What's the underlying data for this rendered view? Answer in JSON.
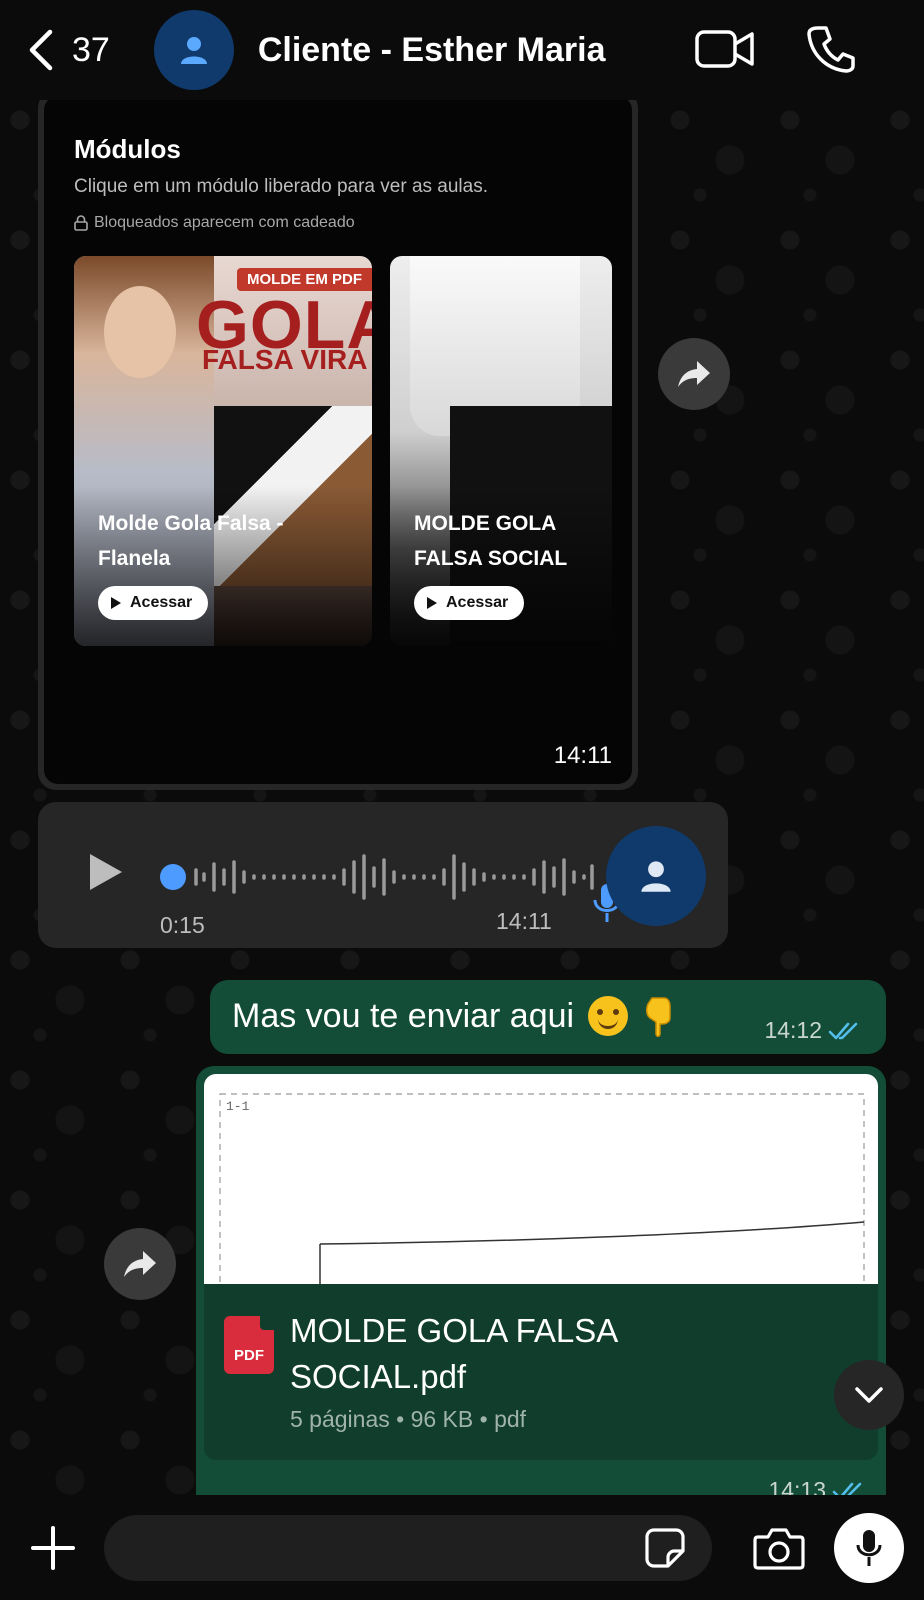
{
  "header": {
    "back_count": "37",
    "contact_name": "Cliente - Esther Maria"
  },
  "image_message": {
    "title": "Módulos",
    "subtitle": "Clique em um módulo liberado para ver as aulas.",
    "lock_note": "Bloqueados aparecem com cadeado",
    "cards": [
      {
        "badge": "MOLDE EM PDF",
        "headline": "GOLA",
        "headline2": "FALSA VIRA",
        "title": "Molde Gola Falsa - Flanela",
        "button": "Acessar"
      },
      {
        "title": "MOLDE GOLA FALSA SOCIAL",
        "button": "Acessar"
      }
    ],
    "time": "14:11"
  },
  "voice_message": {
    "duration": "0:15",
    "time": "14:11"
  },
  "outgoing_text": {
    "text": "Mas vou te enviar aqui",
    "time": "14:12"
  },
  "document_message": {
    "preview_label": "1-1",
    "icon_label": "PDF",
    "file_name": "MOLDE GOLA FALSA SOCIAL.pdf",
    "meta": "5 páginas • 96 KB • pdf",
    "time": "14:13"
  },
  "composer": {
    "placeholder": ""
  },
  "colors": {
    "outgoing_bubble": "#134d37",
    "incoming_bubble": "#262626",
    "read_ticks": "#53bdeb",
    "avatar": "#103a6b"
  }
}
